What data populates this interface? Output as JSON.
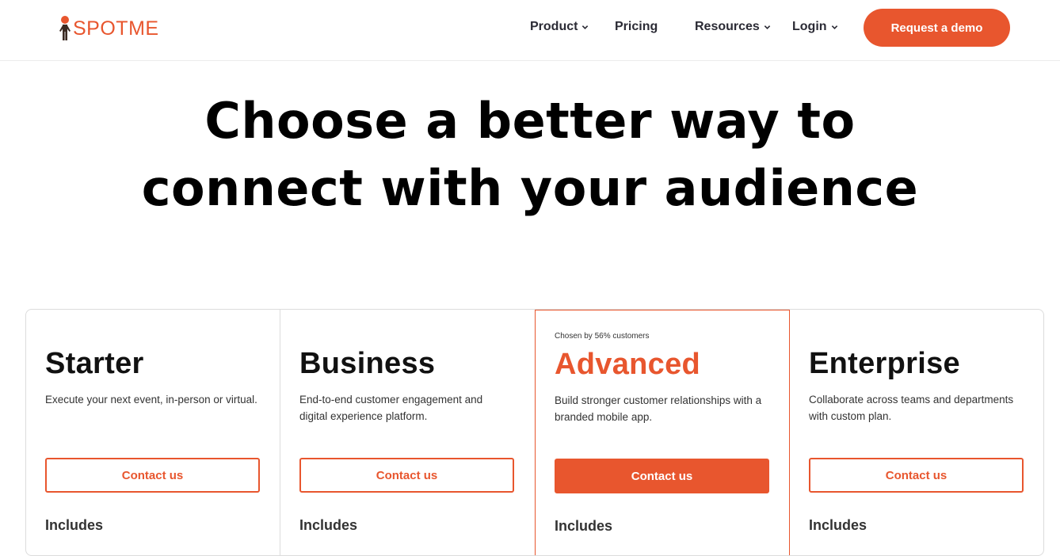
{
  "brand": {
    "name": "SPOTME",
    "accent": "#e8562e"
  },
  "nav": {
    "items": [
      {
        "label": "Product",
        "has_dropdown": true
      },
      {
        "label": "Pricing",
        "has_dropdown": false
      },
      {
        "label": "Resources",
        "has_dropdown": true
      },
      {
        "label": "Login",
        "has_dropdown": true
      }
    ],
    "cta_label": "Request a demo"
  },
  "hero": {
    "line1": "Choose a better way to",
    "line2": "connect with your audience"
  },
  "plans": [
    {
      "name": "Starter",
      "description": "Execute your next event, in-person or virtual.",
      "button": "Contact us",
      "includes": "Includes"
    },
    {
      "name": "Business",
      "description": "End-to-end customer engagement and digital experience platform.",
      "button": "Contact us",
      "includes": "Includes"
    },
    {
      "name": "Advanced",
      "badge": "Chosen by 56% customers",
      "description": "Build stronger customer relationships with a branded mobile app.",
      "button": "Contact us",
      "includes": "Includes",
      "featured": true
    },
    {
      "name": "Enterprise",
      "description": "Collaborate across teams and departments with custom plan.",
      "button": "Contact us",
      "includes": "Includes"
    }
  ],
  "icons": {
    "logo": "person-figure-icon",
    "dropdown": "chevron-down-icon"
  }
}
